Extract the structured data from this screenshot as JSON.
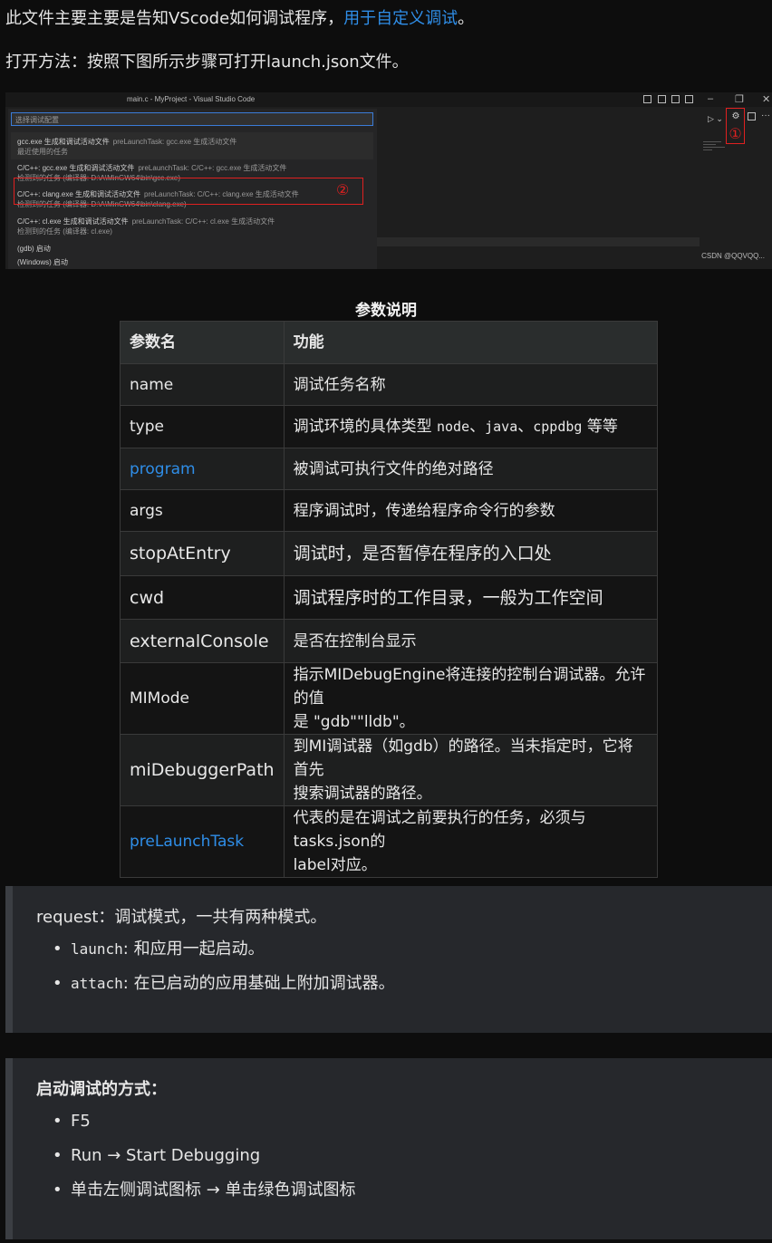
{
  "intro": {
    "line1_text": "此文件主要主要是告知VScode如何调试程序，",
    "line1_link": "用于自定义调试",
    "line1_end": "。",
    "line2": "打开方法：按照下图所示步骤可打开launch.json文件。"
  },
  "screenshot": {
    "window_title": "main.c - MyProject - Visual Studio Code",
    "search_placeholder": "选择调试配置",
    "step1_marker": "①",
    "step2_marker": "②",
    "watermark": "CSDN @QQVQQ...",
    "items": [
      {
        "title": "gcc.exe 生成和调试活动文件",
        "hint": "preLaunchTask: gcc.exe 生成活动文件",
        "sub": "最近使用的任务"
      },
      {
        "title": "C/C++: gcc.exe 生成和调试活动文件",
        "hint": "preLaunchTask: C/C++: gcc.exe 生成活动文件",
        "sub": "检测到的任务 (编译器: D:\\A\\MinGW64\\bin\\gcc.exe)"
      },
      {
        "title": "C/C++: clang.exe 生成和调试活动文件",
        "hint": "preLaunchTask: C/C++: clang.exe 生成活动文件",
        "sub": "检测到的任务 (编译器: D:\\A\\MinGW64\\bin\\clang.exe)"
      },
      {
        "title": "C/C++: cl.exe 生成和调试活动文件",
        "hint": "preLaunchTask: C/C++: cl.exe 生成活动文件",
        "sub": "检测到的任务 (编译器: cl.exe)"
      },
      {
        "title": "(gdb) 启动",
        "hint": "",
        "sub": ""
      },
      {
        "title": "(Windows) 启动",
        "hint": "",
        "sub": ""
      }
    ]
  },
  "table": {
    "caption": "参数说明",
    "headers": [
      "参数名",
      "功能"
    ],
    "rows": [
      {
        "name": "name",
        "desc": "调试任务名称"
      },
      {
        "name": "type",
        "desc_pre": "调试环境的具体类型 ",
        "code1": "node",
        "sep1": "、",
        "code2": "java",
        "sep2": "、",
        "code3": "cppdbg",
        "desc_post": " 等等"
      },
      {
        "name": "program",
        "desc": "被调试可执行文件的绝对路径"
      },
      {
        "name": "args",
        "desc": "程序调试时，传递给程序命令行的参数"
      },
      {
        "name": "stopAtEntry",
        "desc": "调试时，是否暂停在程序的入口处"
      },
      {
        "name": "cwd",
        "desc": "调试程序时的工作目录，一般为工作空间"
      },
      {
        "name": "externalConsole",
        "desc": "是否在控制台显示"
      },
      {
        "name": "MIMode",
        "desc_l1": "指示MIDebugEngine将连接的控制台调试器。允许的值",
        "desc_l2": "是 \"gdb\"\"lldb\"。"
      },
      {
        "name": "miDebuggerPath",
        "desc_l1": "到MI调试器（如gdb）的路径。当未指定时，它将首先",
        "desc_l2": "搜索调试器的路径。"
      },
      {
        "name": "preLaunchTask",
        "desc_l1": "代表的是在调试之前要执行的任务，必须与tasks.json的",
        "desc_l2": "label对应。"
      }
    ]
  },
  "request": {
    "head": "request：调试模式，一共有两种模式。",
    "items": [
      {
        "code": "launch",
        "text": ": 和应用一起启动。"
      },
      {
        "code": "attach",
        "text": ": 在已启动的应用基础上附加调试器。"
      }
    ]
  },
  "start": {
    "head": "启动调试的方式：",
    "items": [
      "F5",
      "Run → Start Debugging",
      "单击左侧调试图标 → 单击绿色调试图标"
    ]
  }
}
